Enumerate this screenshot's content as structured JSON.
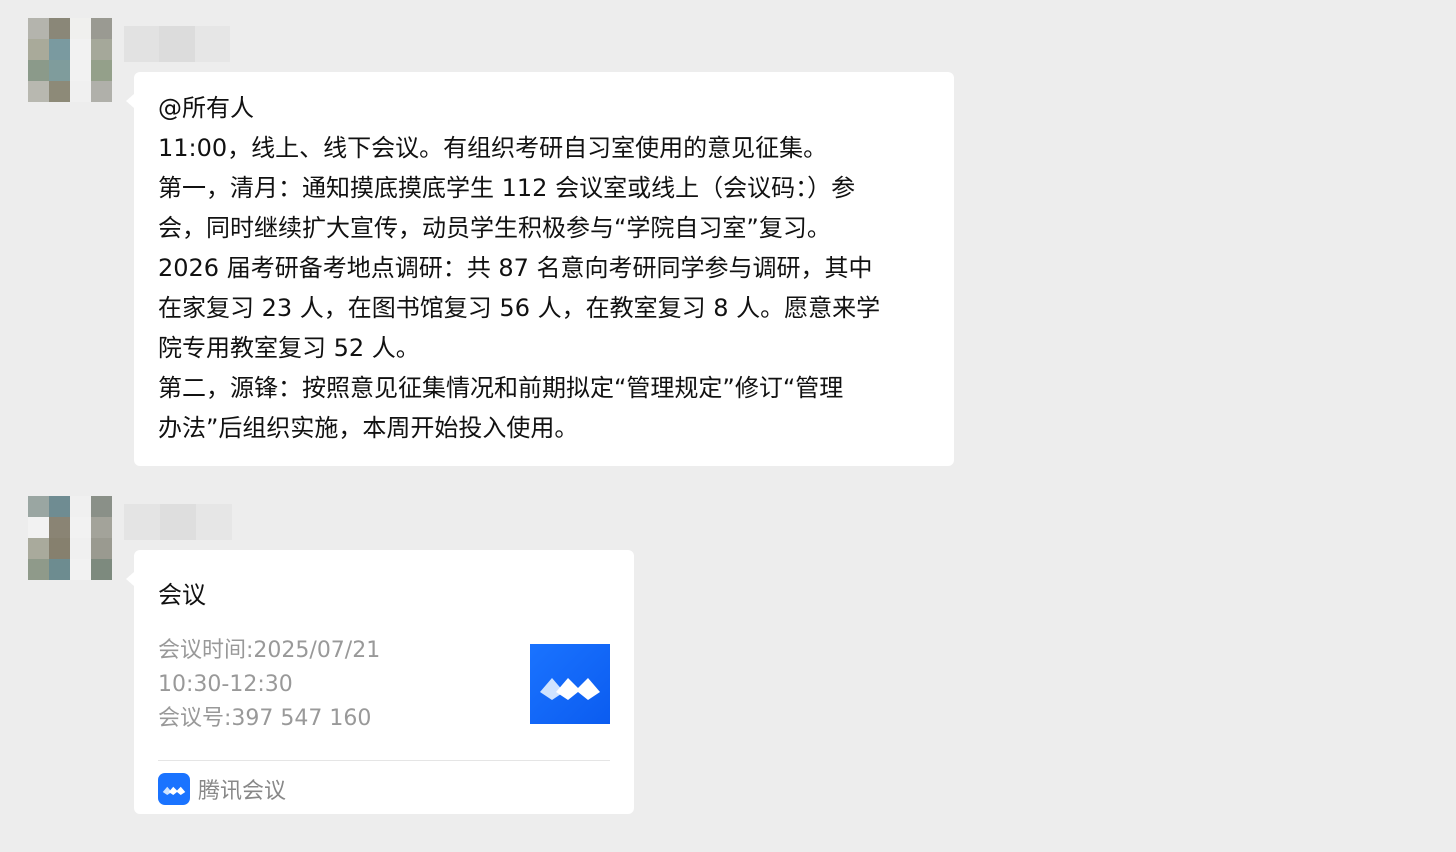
{
  "messages": [
    {
      "type": "text",
      "lines": [
        "@所有人",
        "11:00，线上、线下会议。有组织考研自习室使用的意见征集。",
        "第一，清月：通知摸底摸底学生 112 会议室或线上（会议码：）参",
        "会，同时继续扩大宣传，动员学生积极参与“学院自习室”复习。",
        "2026 届考研备考地点调研：共 87 名意向考研同学参与调研，其中",
        "在家复习 23 人，在图书馆复习 56 人，在教室复习 8 人。愿意来学",
        "院专用教室复习 52 人。",
        "第二，源锋：按照意见征集情况和前期拟定“管理规定”修订“管理",
        "办法”后组织实施，本周开始投入使用。"
      ]
    },
    {
      "type": "card",
      "title": "会议",
      "details": [
        "会议时间:2025/07/21",
        "10:30-12:30",
        "会议号:397 547 160"
      ],
      "thumbnail_icon": "tencent-meeting-logo-icon",
      "source_icon": "tencent-meeting-icon",
      "source_name": "腾讯会议"
    }
  ],
  "colors": {
    "background": "#ededed",
    "bubble": "#ffffff",
    "brand_blue": "#1a73ff",
    "secondary_text": "#999999"
  }
}
